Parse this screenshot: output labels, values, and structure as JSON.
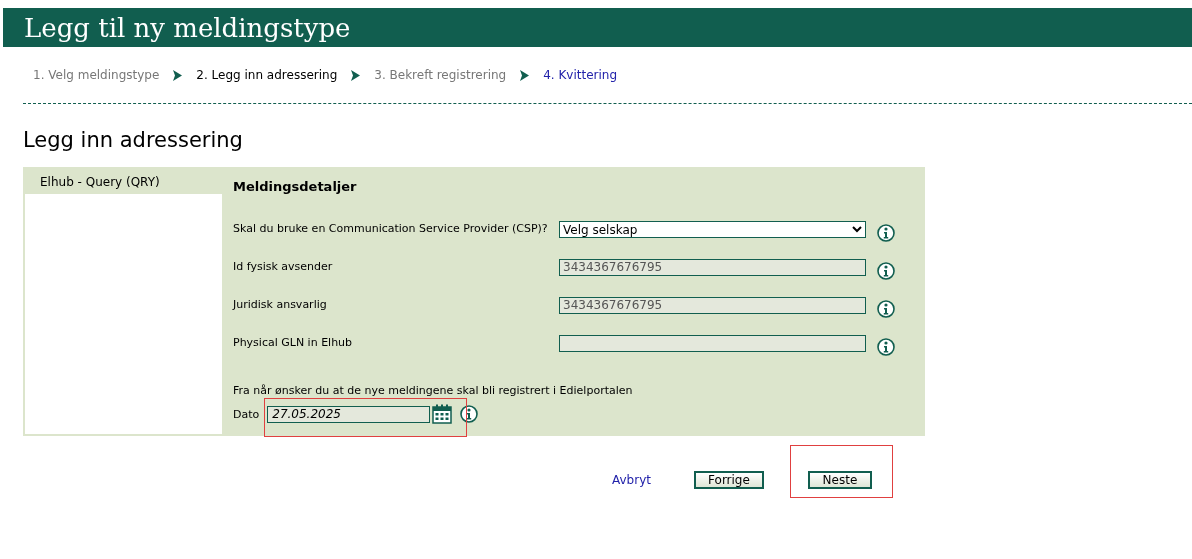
{
  "header": {
    "title": "Legg til ny meldingstype"
  },
  "steps": [
    {
      "label": "1. Velg meldingstype",
      "kind": "text",
      "selected": false
    },
    {
      "label": "2. Legg inn adressering",
      "kind": "text",
      "selected": true
    },
    {
      "label": "3. Bekreft registrering",
      "kind": "text",
      "selected": false
    },
    {
      "label": "4. Kvittering",
      "kind": "link",
      "selected": false
    }
  ],
  "heading": "Legg inn adressering",
  "sidebar": {
    "title": "Elhub - Query (QRY)"
  },
  "form": {
    "title": "Meldingsdetaljer",
    "fields": [
      {
        "kind": "select",
        "label": "Skal du bruke en Communication Service Provider (CSP)?",
        "value": "Velg selskap"
      },
      {
        "kind": "readonly",
        "label": "Id fysisk avsender",
        "value": "3434367676795"
      },
      {
        "kind": "readonly",
        "label": "Juridisk ansvarlig",
        "value": "3434367676795"
      },
      {
        "kind": "text",
        "label": "Physical GLN in Elhub"
      }
    ],
    "date_prompt": "Fra når ønsker du at de nye meldingene skal bli registrert i Edielportalen",
    "date": {
      "label": "Dato",
      "value": "27.05.2025",
      "highlighted": true
    }
  },
  "actions": {
    "cancel": "Avbryt",
    "buttons": [
      {
        "label": "Forrige",
        "highlighted": false
      },
      {
        "label": "Neste",
        "highlighted": true
      }
    ]
  }
}
